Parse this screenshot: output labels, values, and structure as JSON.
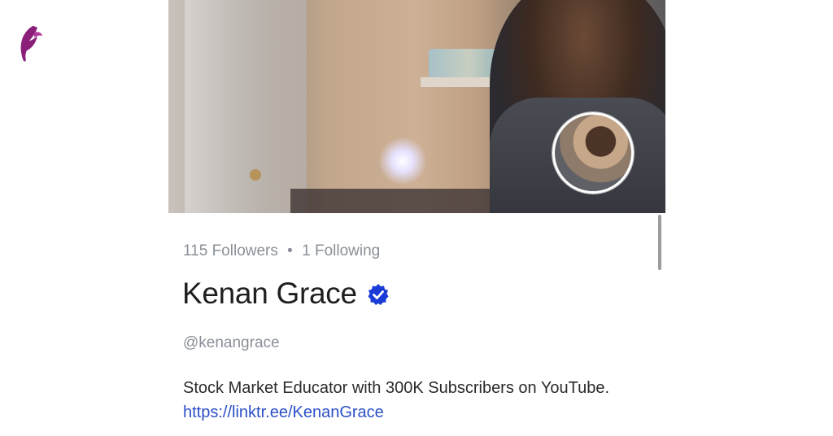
{
  "brand": {
    "logo_icon": "feather-logo-icon",
    "color": "#8a1f7a"
  },
  "profile": {
    "followers_count": "115",
    "followers_label": "Followers",
    "separator": "•",
    "following_count": "1",
    "following_label": "Following",
    "display_name": "Kenan Grace",
    "verified_icon": "verified-badge-icon",
    "verified_color": "#1a3bd6",
    "handle": "@kenangrace",
    "bio_text": "Stock Market Educator with 300K Subscribers on YouTube.",
    "bio_link": "https://linktr.ee/KenanGrace",
    "link_color": "#2c4fc7"
  }
}
